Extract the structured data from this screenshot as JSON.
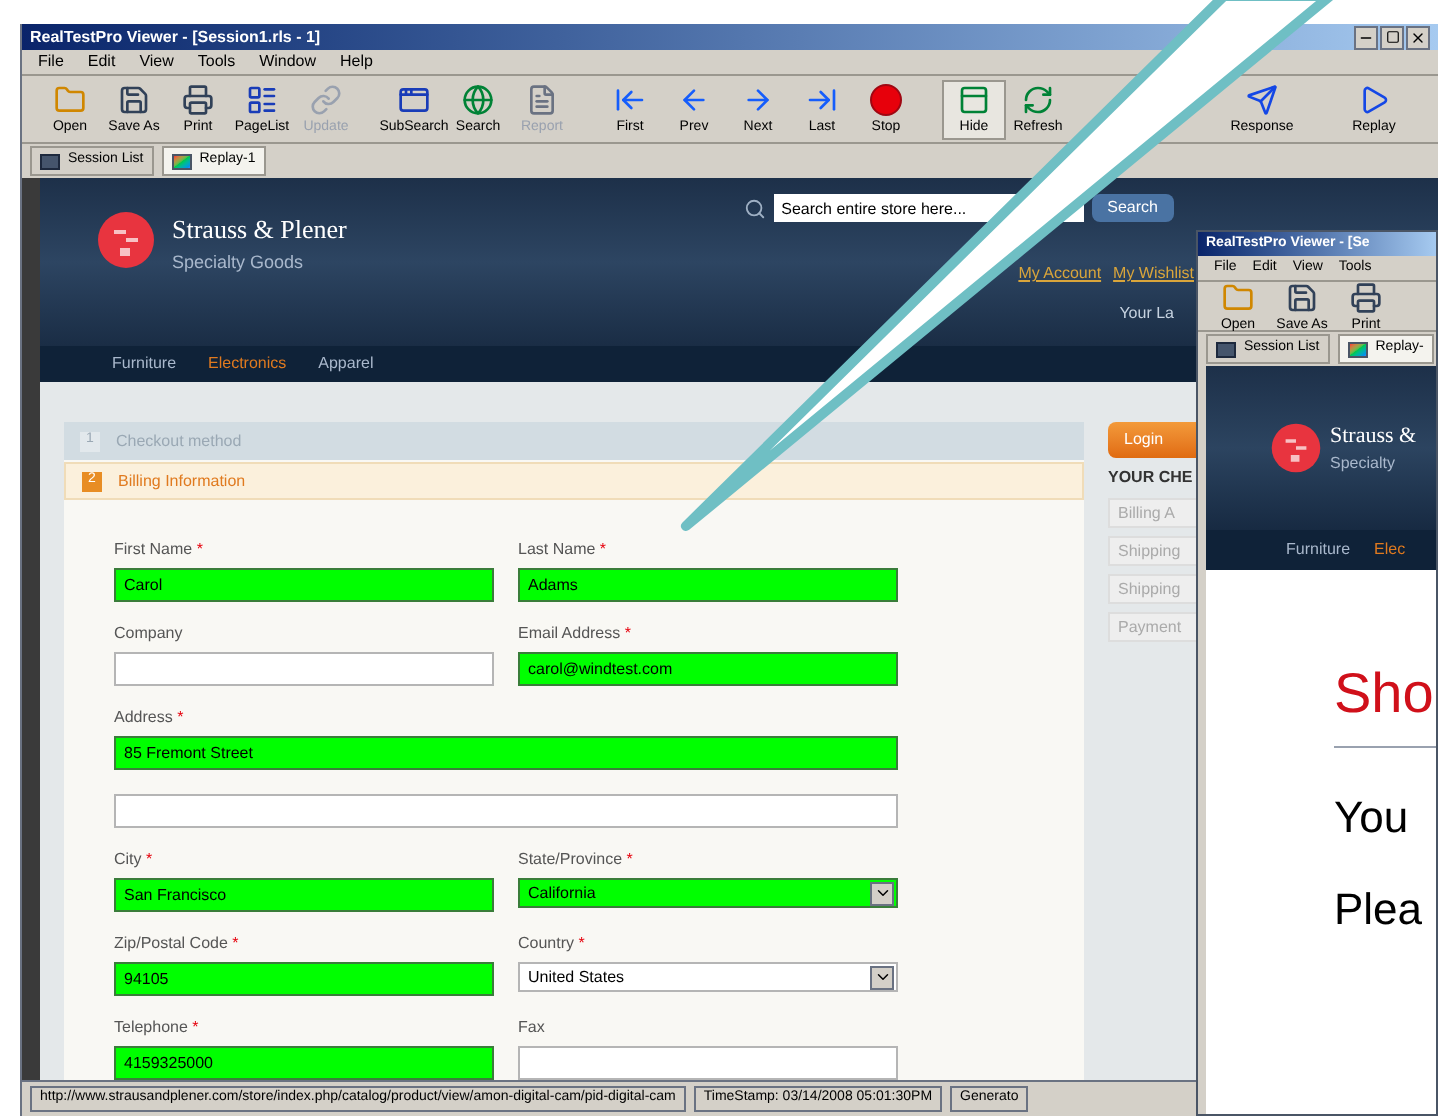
{
  "window": {
    "title": "RealTestPro Viewer - [Session1.rls - 1]"
  },
  "menu": [
    "File",
    "Edit",
    "View",
    "Tools",
    "Window",
    "Help"
  ],
  "toolbar": [
    {
      "label": "Open",
      "kind": "folder",
      "disabled": false,
      "pressed": false
    },
    {
      "label": "Save As",
      "kind": "save",
      "disabled": false,
      "pressed": false
    },
    {
      "label": "Print",
      "kind": "print",
      "disabled": false,
      "pressed": false
    },
    {
      "label": "PageList",
      "kind": "list",
      "disabled": false,
      "pressed": false
    },
    {
      "label": "Update",
      "kind": "link",
      "disabled": true,
      "pressed": false
    },
    {
      "label": "SubSearch",
      "kind": "window",
      "disabled": false,
      "pressed": false
    },
    {
      "label": "Search",
      "kind": "globe",
      "disabled": false,
      "pressed": false
    },
    {
      "label": "Report",
      "kind": "report",
      "disabled": true,
      "pressed": false
    },
    {
      "label": "First",
      "kind": "first",
      "disabled": false,
      "pressed": false
    },
    {
      "label": "Prev",
      "kind": "prev",
      "disabled": false,
      "pressed": false
    },
    {
      "label": "Next",
      "kind": "next",
      "disabled": false,
      "pressed": false
    },
    {
      "label": "Last",
      "kind": "last",
      "disabled": false,
      "pressed": false
    },
    {
      "label": "Stop",
      "kind": "stop",
      "disabled": false,
      "pressed": false
    },
    {
      "label": "Hide",
      "kind": "hide",
      "disabled": false,
      "pressed": true
    },
    {
      "label": "Refresh",
      "kind": "refresh",
      "disabled": false,
      "pressed": false
    },
    {
      "label": "Response",
      "kind": "response",
      "disabled": false,
      "pressed": false
    },
    {
      "label": "Replay",
      "kind": "replay",
      "disabled": false,
      "pressed": false
    }
  ],
  "tabs": [
    {
      "label": "Session List",
      "selected": false
    },
    {
      "label": "Replay-1",
      "selected": true
    }
  ],
  "site": {
    "brand": "Strauss & Plener",
    "tagline": "Specialty Goods",
    "search": {
      "placeholder": "Search entire store here...",
      "button": "Search"
    },
    "links": [
      "My Account",
      "My Wishlist"
    ],
    "language": "Your La",
    "nav": [
      {
        "label": "Furniture",
        "selected": false
      },
      {
        "label": "Electronics",
        "selected": true
      },
      {
        "label": "Apparel",
        "selected": false
      }
    ]
  },
  "checkout": {
    "steps": [
      {
        "number": "1",
        "title": "Checkout method",
        "active": false
      },
      {
        "number": "2",
        "title": "Billing Information",
        "active": true
      }
    ],
    "required_mark": "*",
    "rows": [
      [
        {
          "label": "First Name",
          "required": true,
          "value": "Carol",
          "kind": "text",
          "highlighted": true
        },
        {
          "label": "Last Name",
          "required": true,
          "value": "Adams",
          "kind": "text",
          "highlighted": true
        }
      ],
      [
        {
          "label": "Company",
          "required": false,
          "kind": "text",
          "highlighted": false
        },
        {
          "label": "Email Address",
          "required": true,
          "value": "carol@windtest.com",
          "kind": "text",
          "highlighted": true
        }
      ],
      [
        {
          "label": "Address",
          "required": true,
          "value": "85 Fremont Street",
          "kind": "text",
          "highlighted": true
        }
      ],
      [
        {
          "kind": "text",
          "highlighted": false
        }
      ],
      [
        {
          "label": "City",
          "required": true,
          "value": "San Francisco",
          "kind": "text",
          "highlighted": true
        },
        {
          "label": "State/Province",
          "required": true,
          "value": "California",
          "kind": "select",
          "highlighted": true
        }
      ],
      [
        {
          "label": "Zip/Postal Code",
          "required": true,
          "value": "94105",
          "kind": "text",
          "highlighted": true
        },
        {
          "label": "Country",
          "required": true,
          "value": "United States",
          "kind": "select",
          "highlighted": false
        }
      ],
      [
        {
          "label": "Telephone",
          "required": true,
          "value": "4159325000",
          "kind": "text",
          "highlighted": true
        },
        {
          "label": "Fax",
          "required": false,
          "kind": "text",
          "highlighted": false
        }
      ]
    ]
  },
  "sidebar": {
    "login": "Login",
    "heading": "YOUR CHE",
    "items": [
      "Billing A",
      "Shipping",
      "Shipping",
      "Payment"
    ]
  },
  "status_bar": {
    "url": "http://www.strausandplener.com/store/index.php/catalog/product/view/amon-digital-cam/pid-digital-cam",
    "timestamp": "TimeStamp: 03/14/2008 05:01:30PM",
    "extra": "Generato"
  },
  "second_window": {
    "title": "RealTestPro Viewer - [Se",
    "menu": [
      "File",
      "Edit",
      "View",
      "Tools"
    ],
    "toolbar": [
      {
        "label": "Open",
        "kind": "folder",
        "disabled": false,
        "pressed": false
      },
      {
        "label": "Save As",
        "kind": "save",
        "disabled": false,
        "pressed": false
      },
      {
        "label": "Print",
        "kind": "print",
        "disabled": false,
        "pressed": false
      }
    ],
    "tabs": [
      {
        "label": "Session List",
        "selected": false
      },
      {
        "label": "Replay-",
        "selected": true
      }
    ],
    "brand": "Strauss &",
    "tagline": "Specialty",
    "nav": [
      {
        "label": "Furniture",
        "selected": false
      },
      {
        "label": "Elec",
        "selected": true
      }
    ],
    "heading": "Sho",
    "lines": [
      "You",
      "Plea"
    ]
  }
}
